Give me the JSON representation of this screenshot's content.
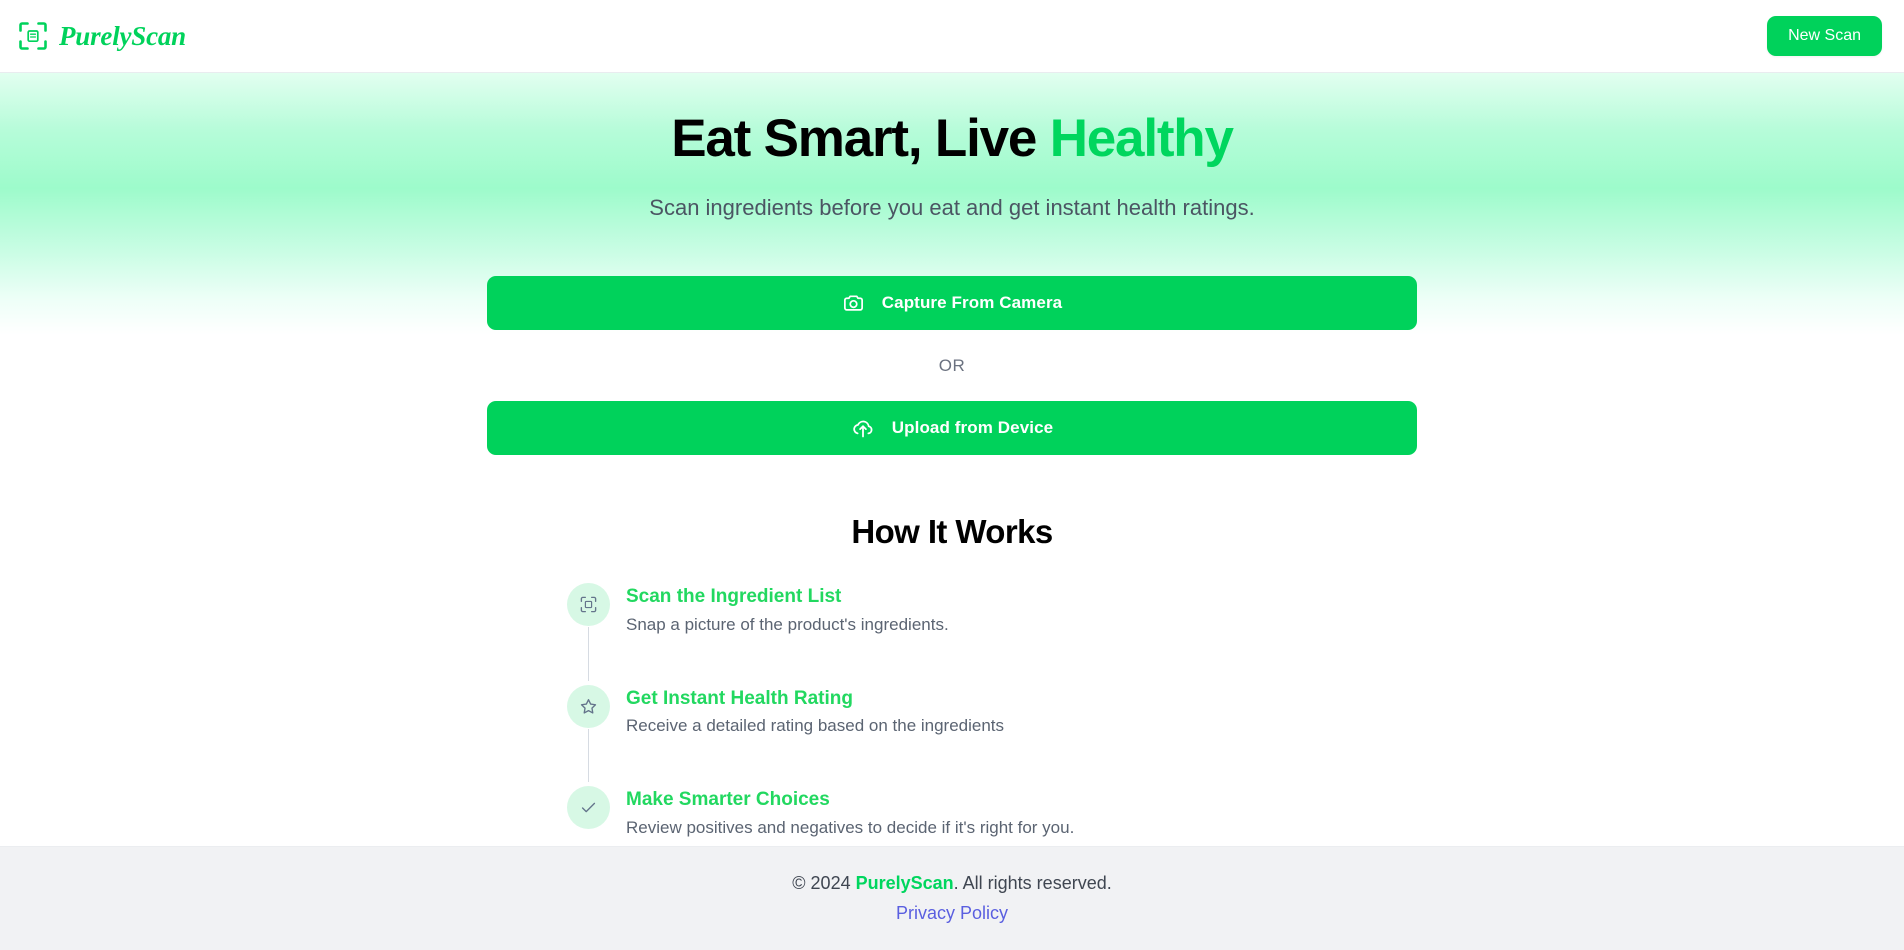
{
  "header": {
    "logo_icon": "scan-frame-icon",
    "brand_name": "PurelyScan",
    "new_scan_label": "New Scan",
    "brand_color": "#00d25b"
  },
  "hero": {
    "title_main": "Eat Smart, Live ",
    "title_accent": "Healthy",
    "subtitle": "Scan ingredients before you eat and get instant health ratings.",
    "gradient_peak_color": "#9dfbcb",
    "accent_color": "#00d65e"
  },
  "actions": {
    "capture_label": "Capture From Camera",
    "capture_icon": "camera-icon",
    "or_label": "OR",
    "upload_label": "Upload from Device",
    "upload_icon": "cloud-upload-icon",
    "button_color": "#00d25b"
  },
  "how_it_works": {
    "heading": "How It Works",
    "steps": [
      {
        "icon": "scan-frame-icon",
        "title": "Scan the Ingredient List",
        "description": "Snap a picture of the product's ingredients."
      },
      {
        "icon": "star-outline-icon",
        "title": "Get Instant Health Rating",
        "description": "Receive a detailed rating based on the ingredients"
      },
      {
        "icon": "check-icon",
        "title": "Make Smarter Choices",
        "description": "Review positives and negatives to decide if it's right for you."
      }
    ]
  },
  "footer": {
    "copyright_prefix": "© 2024 ",
    "brand_name": "PurelyScan",
    "copyright_suffix": ". All rights reserved.",
    "privacy_label": "Privacy Policy",
    "link_color": "#5a5fe0"
  }
}
